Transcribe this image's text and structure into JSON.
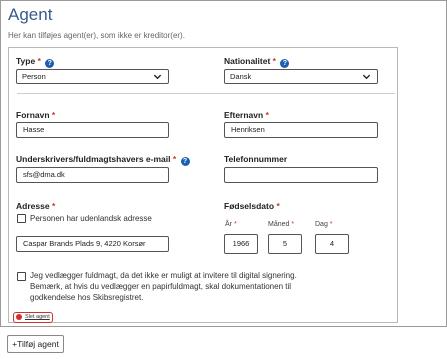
{
  "header": {
    "title": "Agent",
    "subtitle": "Her kan tilføjes agent(er), som ikke er kreditor(er)."
  },
  "form": {
    "type": {
      "label": "Type",
      "required": "*",
      "value": "Person"
    },
    "nationality": {
      "label": "Nationalitet",
      "required": "*",
      "value": "Dansk"
    },
    "first_name": {
      "label": "Fornavn",
      "required": "*",
      "value": "Hasse"
    },
    "last_name": {
      "label": "Efternavn",
      "required": "*",
      "value": "Henriksen"
    },
    "email": {
      "label": "Underskrivers/fuldmagtshavers e-mail",
      "required": "*",
      "value": "sfs@dma.dk"
    },
    "phone": {
      "label": "Telefonnummer",
      "value": ""
    },
    "address": {
      "label": "Adresse",
      "required": "*",
      "foreign_checkbox": "Personen har udenlandsk adresse",
      "value": "Caspar Brands Plads 9, 4220 Korsør"
    },
    "birthdate": {
      "label": "Fødselsdato",
      "required": "*",
      "year_label": "År",
      "month_label": "Måned",
      "day_label": "Dag",
      "year": "1966",
      "month": "5",
      "day": "4"
    },
    "power_of_attorney": "Jeg vedlægger fuldmagt, da det ikke er muligt at invitere til digital signering. Bemærk, at hvis du vedlægger en papirfuldmagt, skal dokumentationen til godkendelse hos Skibsregistret.",
    "delete_label": "Slet agent"
  },
  "add_button": "+Tilføj agent",
  "colors": {
    "title": "#3a5a8c",
    "help": "#1c5fb0",
    "required": "#c0392b",
    "delete": "#d32f2f"
  }
}
